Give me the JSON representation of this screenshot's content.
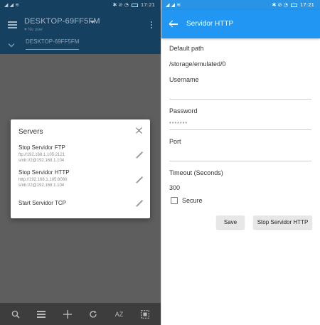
{
  "left": {
    "status": {
      "left_icons": "◢ ◢ ≋",
      "right_icons": "✱ ⊘ ◔",
      "time": "17:21"
    },
    "toolbar": {
      "host": "DESKTOP-69FF5FM",
      "subtitle": "♥ No user",
      "path_tab": "DESKTOP-69FF5FM"
    },
    "dialog": {
      "title": "Servers",
      "servers": [
        {
          "title": "Stop Servidor FTP",
          "lines": [
            "ftp://192.168.1.105:2121",
            "smb://2@192.168.1.104"
          ]
        },
        {
          "title": "Stop Servidor HTTP",
          "lines": [
            "http://192.168.1.105:8080",
            "smb://2@192.168.1.104"
          ]
        },
        {
          "title": "Start Servidor TCP",
          "lines": []
        }
      ]
    },
    "bottom": {
      "az_label": "AZ"
    }
  },
  "right": {
    "status": {
      "left_icons": "◢ ◢ ≋",
      "right_icons": "✱ ⊘ ◔",
      "time": "17:21"
    },
    "appbar": {
      "title": "Servidor HTTP"
    },
    "form": {
      "default_path_label": "Default path",
      "default_path_value": "/storage/emulated/0",
      "username_label": "Username",
      "username_value": "",
      "password_label": "Password",
      "password_value": "*******",
      "port_label": "Port",
      "port_value": "",
      "timeout_label": "Timeout (Seconds)",
      "timeout_value": "300",
      "secure_label": "Secure",
      "secure_checked": false
    },
    "buttons": {
      "save": "Save",
      "stop": "Stop Servidor HTTP"
    }
  }
}
